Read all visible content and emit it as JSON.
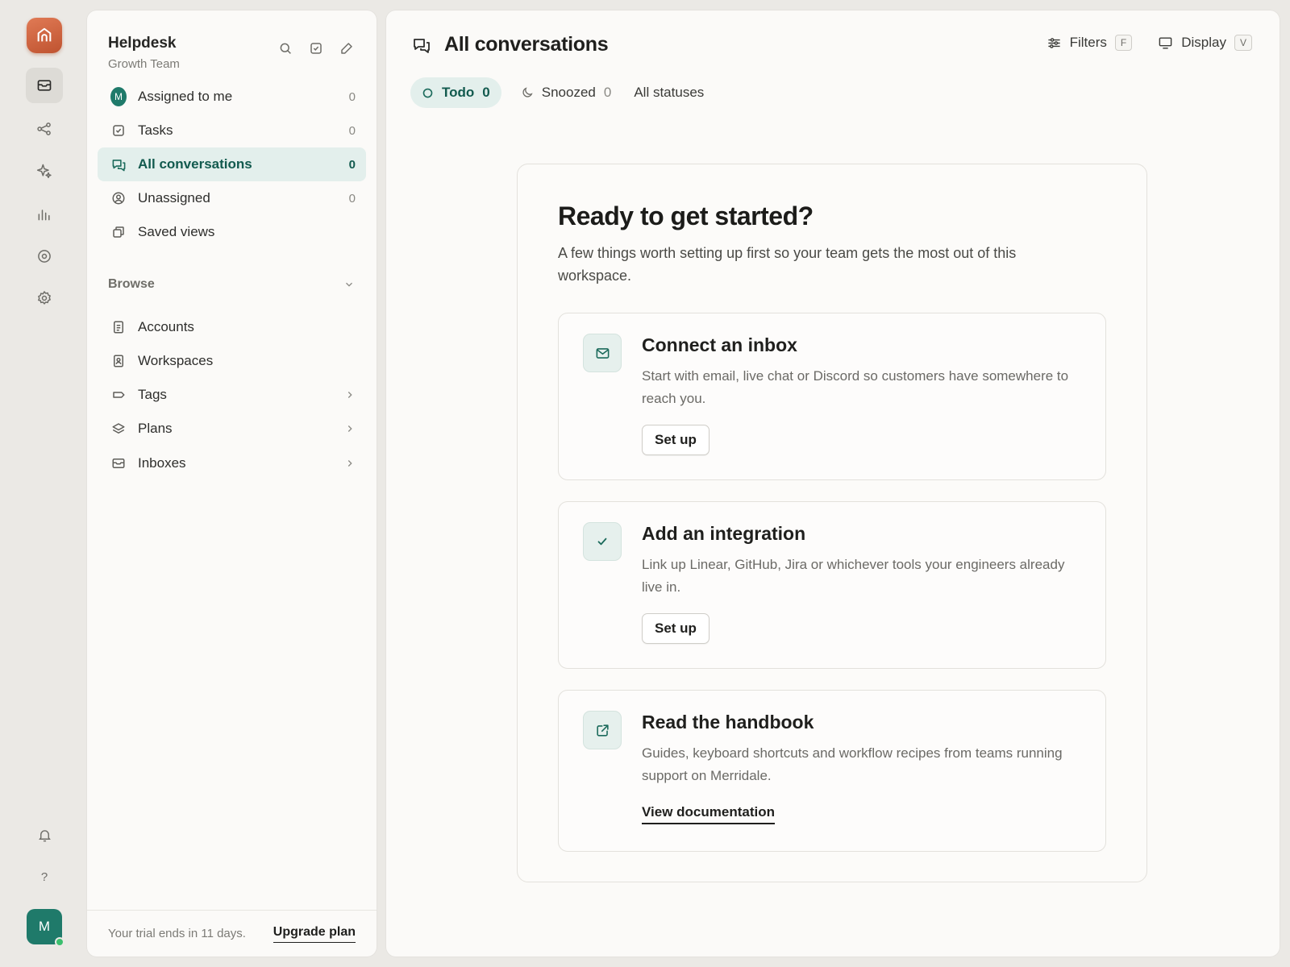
{
  "rail": {
    "logo_icon": "home-icon",
    "items": [
      {
        "icon": "inbox-icon",
        "active": true
      },
      {
        "icon": "share-icon",
        "active": false
      },
      {
        "icon": "sparkle-icon",
        "active": false
      },
      {
        "icon": "bar-chart-icon",
        "active": false
      },
      {
        "icon": "target-icon",
        "active": false
      },
      {
        "icon": "gear-icon",
        "active": false
      }
    ],
    "bell_icon": "bell-icon",
    "help_label": "?",
    "avatar_initial": "M"
  },
  "sidebar": {
    "title": "Helpdesk",
    "subtitle": "Growth Team",
    "nav": [
      {
        "label": "Assigned to me",
        "count": "0",
        "icon": "avatar-icon",
        "avatar_initial": "M"
      },
      {
        "label": "Tasks",
        "count": "0",
        "icon": "checkbox-icon"
      },
      {
        "label": "All conversations",
        "count": "0",
        "icon": "chat-bubbles-icon",
        "active": true
      },
      {
        "label": "Unassigned",
        "count": "0",
        "icon": "user-circle-icon"
      },
      {
        "label": "Saved views",
        "icon": "copy-icon"
      }
    ],
    "browse_label": "Browse",
    "browse": [
      {
        "label": "Accounts",
        "icon": "document-icon"
      },
      {
        "label": "Workspaces",
        "icon": "contact-card-icon"
      },
      {
        "label": "Tags",
        "icon": "tag-icon",
        "chevron": true
      },
      {
        "label": "Plans",
        "icon": "layers-icon",
        "chevron": true
      },
      {
        "label": "Inboxes",
        "icon": "inbox-icon",
        "chevron": true
      }
    ],
    "trial_text": "Your trial ends in 11 days.",
    "upgrade_label": "Upgrade plan"
  },
  "main": {
    "title": "All conversations",
    "filters_label": "Filters",
    "filters_key": "F",
    "display_label": "Display",
    "display_key": "V",
    "tabs": [
      {
        "label": "Todo",
        "count": "0",
        "active": true
      },
      {
        "label": "Snoozed",
        "count": "0"
      },
      {
        "label": "All statuses"
      }
    ],
    "onboarding": {
      "heading": "Ready to get started?",
      "intro": "A few things worth setting up first so your team gets the most out of this workspace.",
      "cards": [
        {
          "title": "Connect an inbox",
          "desc": "Start with email, live chat or Discord so customers have somewhere to reach you.",
          "action": "Set up",
          "icon": "mail-icon"
        },
        {
          "title": "Add an integration",
          "desc": "Link up Linear, GitHub, Jira or whichever tools your engineers already live in.",
          "action": "Set up",
          "icon": "check-icon"
        },
        {
          "title": "Read the handbook",
          "desc": "Guides, keyboard shortcuts and workflow recipes from teams running support on Merridale.",
          "action": "View documentation",
          "icon": "external-link-icon"
        }
      ]
    }
  },
  "colors": {
    "accent": "#1b6a5b",
    "accent_bg": "#e3efec",
    "logo": "#d0643f",
    "background": "#ebe9e5"
  }
}
